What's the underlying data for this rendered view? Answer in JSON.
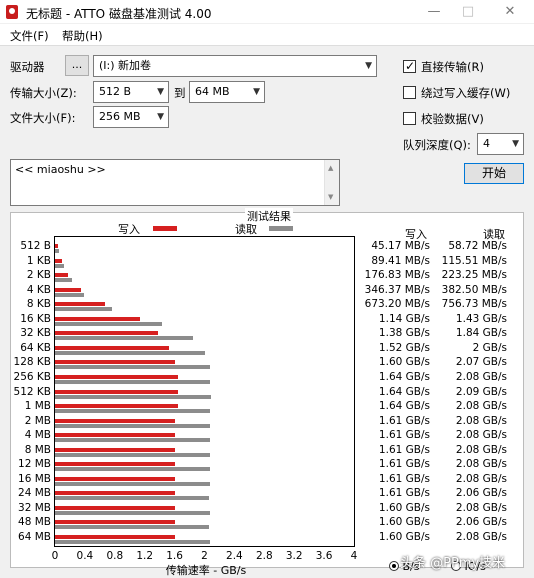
{
  "window": {
    "title": "无标题 - ATTO 磁盘基准测试 4.00",
    "minimize": "—",
    "maximize": "□",
    "close": "✕"
  },
  "menu": [
    "文件(F)",
    "帮助(H)"
  ],
  "controls": {
    "drive_label": "驱动器",
    "browse_button": "...",
    "drive_value": "(I:) 新加卷",
    "transfer_label": "传输大小(Z):",
    "transfer_from": "512 B",
    "to_label": "到",
    "transfer_to": "64 MB",
    "filesize_label": "文件大小(F):",
    "filesize_value": "256 MB",
    "direct_io": {
      "label": "直接传输(R)",
      "checked": true
    },
    "bypass_cache": {
      "label": "绕过写入缓存(W)",
      "checked": false
    },
    "verify": {
      "label": "校验数据(V)",
      "checked": false
    },
    "queue_label": "队列深度(Q):",
    "queue_value": "4",
    "start_button": "开始",
    "description": "<< miaoshu >>"
  },
  "results": {
    "header": "测试结果",
    "write_legend": "写入",
    "read_legend": "读取",
    "write_col": "写入",
    "read_col": "读取",
    "x_axis_title": "传输速率 - GB/s",
    "x_ticks": [
      "0",
      "0.4",
      "0.8",
      "1.2",
      "1.6",
      "2",
      "2.4",
      "2.8",
      "3.2",
      "3.6",
      "4"
    ],
    "unit_bs": "B/s",
    "unit_ios": "IO/s",
    "colors": {
      "write": "#d62020",
      "read": "#8c8c8c"
    }
  },
  "chart_data": {
    "type": "bar",
    "orientation": "horizontal",
    "xlim": [
      0,
      4
    ],
    "categories": [
      "512 B",
      "1 KB",
      "2 KB",
      "4 KB",
      "8 KB",
      "16 KB",
      "32 KB",
      "64 KB",
      "128 KB",
      "256 KB",
      "512 KB",
      "1 MB",
      "2 MB",
      "4 MB",
      "8 MB",
      "12 MB",
      "16 MB",
      "24 MB",
      "32 MB",
      "48 MB",
      "64 MB"
    ],
    "series": [
      {
        "name": "写入",
        "values": [
          0.04517,
          0.08941,
          0.17683,
          0.34637,
          0.6732,
          1.14,
          1.38,
          1.52,
          1.6,
          1.64,
          1.64,
          1.64,
          1.61,
          1.61,
          1.61,
          1.61,
          1.61,
          1.61,
          1.6,
          1.6,
          1.6
        ],
        "labels": [
          "45.17 MB/s",
          "89.41 MB/s",
          "176.83 MB/s",
          "346.37 MB/s",
          "673.20 MB/s",
          "1.14 GB/s",
          "1.38 GB/s",
          "1.52 GB/s",
          "1.60 GB/s",
          "1.64 GB/s",
          "1.64 GB/s",
          "1.64 GB/s",
          "1.61 GB/s",
          "1.61 GB/s",
          "1.61 GB/s",
          "1.61 GB/s",
          "1.61 GB/s",
          "1.61 GB/s",
          "1.60 GB/s",
          "1.60 GB/s",
          "1.60 GB/s"
        ]
      },
      {
        "name": "读取",
        "values": [
          0.05872,
          0.11551,
          0.22325,
          0.3825,
          0.75673,
          1.43,
          1.84,
          2.0,
          2.07,
          2.08,
          2.09,
          2.08,
          2.08,
          2.08,
          2.08,
          2.08,
          2.08,
          2.06,
          2.08,
          2.06,
          2.08
        ],
        "labels": [
          "58.72 MB/s",
          "115.51 MB/s",
          "223.25 MB/s",
          "382.50 MB/s",
          "756.73 MB/s",
          "1.43 GB/s",
          "1.84 GB/s",
          "2 GB/s",
          "2.07 GB/s",
          "2.08 GB/s",
          "2.09 GB/s",
          "2.08 GB/s",
          "2.08 GB/s",
          "2.08 GB/s",
          "2.08 GB/s",
          "2.08 GB/s",
          "2.08 GB/s",
          "2.06 GB/s",
          "2.08 GB/s",
          "2.06 GB/s",
          "2.08 GB/s"
        ]
      }
    ]
  },
  "watermark": "头条 @PPmy技米"
}
